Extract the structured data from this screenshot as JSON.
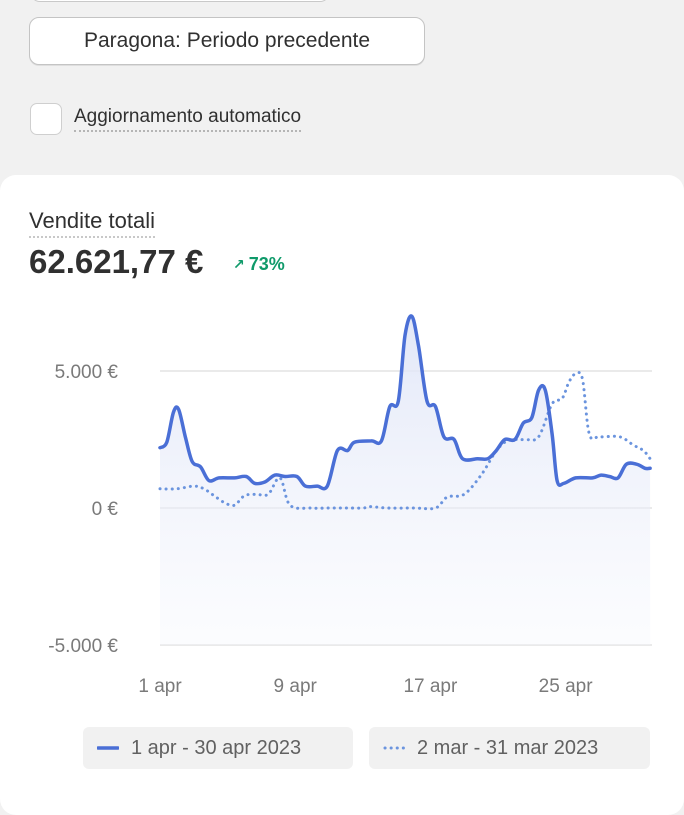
{
  "controls": {
    "compare_label": "Paragona: Periodo precedente",
    "auto_refresh_label": "Aggiornamento automatico"
  },
  "metric": {
    "title": "Vendite totali",
    "value": "62.621,77 €",
    "change": "73%",
    "change_icon": "arrow-up-right-icon"
  },
  "colors": {
    "current": "#4a6fd6",
    "previous": "#6b94de",
    "positive": "#0f9a6a"
  },
  "chart_data": {
    "type": "line",
    "title": "Vendite totali",
    "y_ticks": [
      5000,
      0,
      -5000
    ],
    "y_tick_labels": [
      "5.000 €",
      "0 €",
      "-5.000 €"
    ],
    "ylim": [
      -5000,
      7000
    ],
    "x_tick_days": [
      1,
      9,
      17,
      25
    ],
    "x_tick_labels": [
      "1 apr",
      "9 apr",
      "17 apr",
      "25 apr"
    ],
    "xlim": [
      1,
      30
    ],
    "grid": true,
    "legend_placement": "bottom",
    "series": [
      {
        "name": "1 apr - 30 apr 2023",
        "style": "solid",
        "points": [
          [
            1,
            2200
          ],
          [
            1.4,
            2400
          ],
          [
            1.8,
            3500
          ],
          [
            2.1,
            3600
          ],
          [
            2.5,
            2600
          ],
          [
            2.9,
            1700
          ],
          [
            3.4,
            1500
          ],
          [
            3.9,
            1000
          ],
          [
            4.5,
            1100
          ],
          [
            5.4,
            1100
          ],
          [
            6.1,
            1150
          ],
          [
            6.6,
            900
          ],
          [
            7.2,
            950
          ],
          [
            7.8,
            1200
          ],
          [
            8.4,
            1150
          ],
          [
            9.1,
            1150
          ],
          [
            9.6,
            800
          ],
          [
            10.3,
            800
          ],
          [
            10.9,
            800
          ],
          [
            11.5,
            2100
          ],
          [
            12.1,
            2100
          ],
          [
            12.5,
            2400
          ],
          [
            13.5,
            2450
          ],
          [
            14.1,
            2450
          ],
          [
            14.6,
            3700
          ],
          [
            15.1,
            3900
          ],
          [
            15.5,
            6300
          ],
          [
            15.9,
            7000
          ],
          [
            16.3,
            5900
          ],
          [
            16.8,
            3900
          ],
          [
            17.3,
            3700
          ],
          [
            17.8,
            2600
          ],
          [
            18.4,
            2500
          ],
          [
            18.9,
            1800
          ],
          [
            19.8,
            1800
          ],
          [
            20.4,
            1800
          ],
          [
            20.9,
            2100
          ],
          [
            21.4,
            2500
          ],
          [
            22,
            2500
          ],
          [
            22.5,
            3100
          ],
          [
            23,
            3300
          ],
          [
            23.4,
            4300
          ],
          [
            23.8,
            4300
          ],
          [
            24.2,
            2700
          ],
          [
            24.5,
            1000
          ],
          [
            24.9,
            900
          ],
          [
            25.6,
            1100
          ],
          [
            26.6,
            1100
          ],
          [
            27.1,
            1200
          ],
          [
            27.6,
            1150
          ],
          [
            28.1,
            1100
          ],
          [
            28.6,
            1600
          ],
          [
            29.2,
            1600
          ],
          [
            29.7,
            1450
          ],
          [
            30,
            1450
          ]
        ]
      },
      {
        "name": "2 mar - 31 mar 2023",
        "style": "dotted",
        "points": [
          [
            1,
            700
          ],
          [
            2,
            700
          ],
          [
            3,
            800
          ],
          [
            3.6,
            700
          ],
          [
            4.2,
            450
          ],
          [
            4.8,
            200
          ],
          [
            5.4,
            100
          ],
          [
            6,
            450
          ],
          [
            6.7,
            500
          ],
          [
            7.4,
            500
          ],
          [
            8.1,
            1100
          ],
          [
            8.7,
            100
          ],
          [
            10,
            0
          ],
          [
            11,
            0
          ],
          [
            12,
            0
          ],
          [
            13,
            0
          ],
          [
            13.5,
            50
          ],
          [
            14.4,
            0
          ],
          [
            16,
            0
          ],
          [
            17.3,
            0
          ],
          [
            18,
            400
          ],
          [
            19,
            500
          ],
          [
            20,
            1200
          ],
          [
            20.8,
            2000
          ],
          [
            21.4,
            2400
          ],
          [
            22,
            2500
          ],
          [
            22.6,
            2500
          ],
          [
            23.4,
            2600
          ],
          [
            24.2,
            3800
          ],
          [
            24.8,
            4000
          ],
          [
            25.2,
            4600
          ],
          [
            25.6,
            4900
          ],
          [
            26,
            4700
          ],
          [
            26.4,
            2700
          ],
          [
            27,
            2600
          ],
          [
            28.2,
            2600
          ],
          [
            29,
            2300
          ],
          [
            29.6,
            2100
          ],
          [
            30,
            1800
          ]
        ]
      }
    ]
  }
}
